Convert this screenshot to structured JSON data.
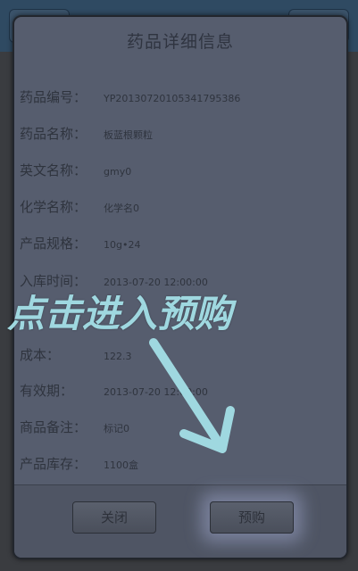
{
  "dialog": {
    "title": "药品详细信息",
    "rows": [
      {
        "label": "药品编号：",
        "value": "YP2013072010534179538​6"
      },
      {
        "label": "药品名称：",
        "value": "板蓝根颗粒"
      },
      {
        "label": "英文名称：",
        "value": "gmy0"
      },
      {
        "label": "化学名称：",
        "value": "化学名0"
      },
      {
        "label": "产品规格：",
        "value": "10g•24"
      },
      {
        "label": "入库时间：",
        "value": "2013-07-20 12:00:00"
      },
      {
        "label": "成本：",
        "value": "122.3"
      },
      {
        "label": "有效期：",
        "value": "2013-07-20 12:00:00"
      },
      {
        "label": "商品备注：",
        "value": "标记0"
      },
      {
        "label": "产品库存：",
        "value": "1100盒"
      }
    ],
    "buttons": {
      "close": "关闭",
      "preorder": "预购"
    }
  },
  "annotation": {
    "text": "点击进入预购",
    "color": "#9fd8e0"
  }
}
